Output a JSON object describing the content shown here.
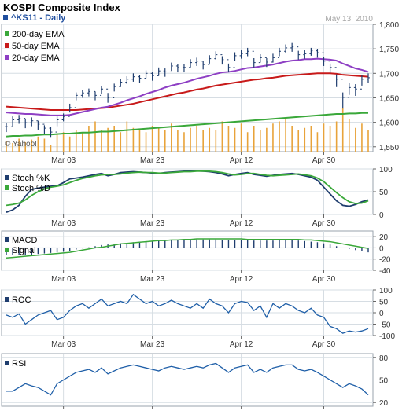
{
  "chart_data": [
    {
      "type": "ohlc",
      "title": "KOSPI Composite Index",
      "ticker": "^KS11 - Daily",
      "date": "May 13, 2010",
      "watermark": "© Yahoo!",
      "ylim": [
        1540,
        1800
      ],
      "yticks": [
        "1,800",
        "1,750",
        "1,700",
        "1,650",
        "1,600",
        "1,550"
      ],
      "ytick_values": [
        1800,
        1750,
        1700,
        1650,
        1600,
        1550
      ],
      "x_labels": [
        "Mar 03",
        "Mar 23",
        "Apr 12",
        "Apr 30"
      ],
      "x_label_index": [
        9,
        23,
        37,
        50
      ],
      "legend": [
        "200-day EMA",
        "50-day EMA",
        "20-day EMA"
      ],
      "close": [
        1591,
        1605,
        1608,
        1599,
        1603,
        1596,
        1588,
        1580,
        1605,
        1612,
        1630,
        1655,
        1660,
        1663,
        1655,
        1668,
        1650,
        1673,
        1682,
        1688,
        1693,
        1690,
        1700,
        1695,
        1705,
        1703,
        1715,
        1712,
        1712,
        1722,
        1725,
        1718,
        1730,
        1738,
        1728,
        1712,
        1736,
        1740,
        1745,
        1722,
        1732,
        1723,
        1732,
        1745,
        1752,
        1754,
        1738,
        1740,
        1746,
        1742,
        1725,
        1712,
        1688,
        1651,
        1671,
        1668,
        1688,
        1691
      ],
      "high": [
        1598,
        1612,
        1615,
        1606,
        1610,
        1603,
        1594,
        1590,
        1612,
        1618,
        1638,
        1661,
        1666,
        1669,
        1663,
        1674,
        1660,
        1679,
        1688,
        1694,
        1700,
        1697,
        1706,
        1702,
        1712,
        1710,
        1722,
        1719,
        1719,
        1729,
        1732,
        1726,
        1737,
        1745,
        1735,
        1720,
        1743,
        1747,
        1752,
        1731,
        1739,
        1731,
        1740,
        1752,
        1759,
        1762,
        1746,
        1747,
        1752,
        1750,
        1733,
        1720,
        1698,
        1661,
        1680,
        1678,
        1697,
        1700
      ],
      "low": [
        1580,
        1592,
        1597,
        1588,
        1592,
        1585,
        1576,
        1570,
        1592,
        1602,
        1620,
        1645,
        1650,
        1653,
        1645,
        1658,
        1640,
        1663,
        1672,
        1678,
        1683,
        1680,
        1690,
        1685,
        1695,
        1693,
        1705,
        1702,
        1702,
        1712,
        1715,
        1708,
        1720,
        1728,
        1718,
        1702,
        1726,
        1730,
        1735,
        1712,
        1722,
        1713,
        1722,
        1735,
        1742,
        1744,
        1728,
        1730,
        1736,
        1732,
        1715,
        1700,
        1672,
        1628,
        1656,
        1654,
        1675,
        1680
      ],
      "ema20": [
        1620,
        1619,
        1618,
        1617,
        1617,
        1616,
        1615,
        1614,
        1614,
        1614,
        1615,
        1618,
        1621,
        1624,
        1627,
        1630,
        1632,
        1636,
        1640,
        1645,
        1649,
        1653,
        1658,
        1662,
        1666,
        1671,
        1675,
        1678,
        1681,
        1685,
        1689,
        1692,
        1695,
        1699,
        1702,
        1703,
        1705,
        1708,
        1711,
        1712,
        1714,
        1716,
        1718,
        1721,
        1724,
        1726,
        1727,
        1729,
        1729,
        1730,
        1729,
        1728,
        1726,
        1720,
        1715,
        1710,
        1707,
        1703
      ],
      "ema50": [
        1632,
        1631,
        1630,
        1629,
        1628,
        1627,
        1626,
        1625,
        1625,
        1625,
        1625,
        1625,
        1626,
        1627,
        1628,
        1629,
        1630,
        1632,
        1634,
        1636,
        1638,
        1641,
        1644,
        1647,
        1650,
        1653,
        1656,
        1659,
        1661,
        1664,
        1667,
        1669,
        1672,
        1675,
        1677,
        1679,
        1681,
        1683,
        1685,
        1687,
        1688,
        1690,
        1691,
        1693,
        1695,
        1696,
        1697,
        1698,
        1699,
        1700,
        1700,
        1700,
        1699,
        1697,
        1696,
        1695,
        1694,
        1693
      ],
      "ema200": [
        1571,
        1572,
        1572,
        1573,
        1573,
        1574,
        1575,
        1575,
        1576,
        1577,
        1577,
        1578,
        1579,
        1579,
        1580,
        1581,
        1581,
        1582,
        1583,
        1584,
        1585,
        1586,
        1587,
        1588,
        1589,
        1590,
        1591,
        1592,
        1593,
        1594,
        1595,
        1596,
        1597,
        1598,
        1599,
        1600,
        1601,
        1602,
        1603,
        1604,
        1605,
        1606,
        1607,
        1608,
        1609,
        1610,
        1611,
        1612,
        1613,
        1614,
        1615,
        1616,
        1617,
        1617,
        1618,
        1618,
        1619,
        1619
      ],
      "volume": [
        0.25,
        0.2,
        0.3,
        0.22,
        0.28,
        0.35,
        0.3,
        0.15,
        0.4,
        0.45,
        0.35,
        0.5,
        0.45,
        0.6,
        0.7,
        0.5,
        0.55,
        0.6,
        0.45,
        0.7,
        0.55,
        0.5,
        0.45,
        0.6,
        0.55,
        0.5,
        0.65,
        0.5,
        0.45,
        0.55,
        0.6,
        0.5,
        0.55,
        0.5,
        0.7,
        0.6,
        0.55,
        0.65,
        0.45,
        0.6,
        0.5,
        0.55,
        0.65,
        0.7,
        0.75,
        0.6,
        0.5,
        0.55,
        0.6,
        0.45,
        0.65,
        0.6,
        0.7,
        1.0,
        0.75,
        0.55,
        0.65,
        0.5
      ]
    },
    {
      "type": "line",
      "ylim": [
        0,
        100
      ],
      "yticks": [
        "100",
        "50",
        "0"
      ],
      "ytick_values": [
        100,
        50,
        0
      ],
      "legend": [
        "Stoch %K",
        "Stoch %D"
      ],
      "series": [
        {
          "name": "Stoch %K",
          "values": [
            5,
            10,
            20,
            40,
            55,
            58,
            60,
            62,
            63,
            70,
            78,
            80,
            82,
            85,
            88,
            90,
            85,
            88,
            92,
            93,
            94,
            93,
            92,
            91,
            90,
            92,
            93,
            94,
            95,
            95,
            96,
            95,
            94,
            92,
            89,
            85,
            88,
            90,
            92,
            88,
            86,
            84,
            86,
            88,
            89,
            90,
            88,
            85,
            82,
            75,
            60,
            45,
            30,
            20,
            18,
            22,
            28,
            32
          ]
        },
        {
          "name": "Stoch %D",
          "values": [
            20,
            22,
            25,
            32,
            42,
            50,
            56,
            60,
            62,
            65,
            70,
            75,
            79,
            82,
            85,
            87,
            88,
            88,
            89,
            91,
            92,
            93,
            92,
            92,
            91,
            91,
            92,
            93,
            94,
            94,
            95,
            95,
            95,
            94,
            92,
            89,
            87,
            88,
            90,
            90,
            88,
            86,
            85,
            86,
            87,
            88,
            89,
            87,
            85,
            80,
            72,
            60,
            48,
            37,
            28,
            24,
            25,
            30
          ]
        }
      ]
    },
    {
      "type": "bar+line",
      "ylim": [
        -40,
        30
      ],
      "yticks": [
        "20",
        "0",
        "-20",
        "-40"
      ],
      "ytick_values": [
        20,
        0,
        -20,
        -40
      ],
      "legend": [
        "MACD",
        "Signal"
      ],
      "histogram": [
        -12,
        -13,
        -13,
        -12,
        -12,
        -11,
        -10,
        -9,
        -8,
        -7,
        -5,
        -3,
        -1,
        1,
        3,
        5,
        6,
        7,
        8,
        9,
        10,
        11,
        12,
        12,
        13,
        13,
        14,
        14,
        15,
        15,
        15,
        15,
        15,
        15,
        14,
        14,
        14,
        14,
        14,
        13,
        13,
        13,
        13,
        14,
        14,
        14,
        13,
        12,
        11,
        10,
        8,
        6,
        3,
        0,
        -2,
        -4,
        -6,
        -8
      ],
      "signal": [
        -18,
        -17,
        -16,
        -15,
        -14,
        -13,
        -12,
        -11,
        -10,
        -9,
        -8,
        -6,
        -4,
        -2,
        0,
        1,
        3,
        5,
        7,
        8,
        9,
        10,
        11,
        12,
        13,
        13,
        14,
        14,
        15,
        15,
        16,
        16,
        16,
        16,
        16,
        16,
        16,
        16,
        15,
        15,
        15,
        15,
        15,
        15,
        15,
        15,
        15,
        14,
        14,
        13,
        12,
        11,
        9,
        7,
        5,
        3,
        1,
        -1
      ]
    },
    {
      "type": "line",
      "ylim": [
        -100,
        100
      ],
      "yticks": [
        "100",
        "50",
        "0",
        "-50",
        "-100"
      ],
      "ytick_values": [
        100,
        50,
        0,
        -50,
        -100
      ],
      "legend": [
        "ROC"
      ],
      "series": [
        {
          "name": "ROC",
          "values": [
            -10,
            -20,
            -5,
            -50,
            -30,
            -10,
            0,
            10,
            -30,
            -20,
            10,
            30,
            40,
            20,
            40,
            60,
            30,
            40,
            50,
            40,
            80,
            60,
            40,
            50,
            30,
            40,
            55,
            40,
            30,
            20,
            40,
            20,
            60,
            40,
            30,
            0,
            40,
            50,
            45,
            10,
            30,
            -20,
            40,
            20,
            40,
            30,
            10,
            0,
            20,
            -10,
            -20,
            -60,
            -70,
            -90,
            -80,
            -85,
            -80,
            -70
          ]
        }
      ]
    },
    {
      "type": "line",
      "ylim": [
        15,
        85
      ],
      "yticks": [
        "80",
        "50",
        "20"
      ],
      "ytick_values": [
        80,
        50,
        20
      ],
      "legend": [
        "RSI"
      ],
      "series": [
        {
          "name": "RSI",
          "values": [
            35,
            35,
            40,
            45,
            42,
            40,
            35,
            30,
            45,
            50,
            55,
            60,
            62,
            64,
            60,
            66,
            58,
            62,
            66,
            68,
            70,
            68,
            66,
            64,
            62,
            66,
            68,
            66,
            64,
            66,
            68,
            66,
            70,
            72,
            66,
            60,
            66,
            68,
            70,
            60,
            64,
            60,
            66,
            68,
            70,
            70,
            64,
            62,
            64,
            60,
            55,
            50,
            45,
            40,
            45,
            42,
            38,
            30
          ]
        }
      ]
    }
  ]
}
